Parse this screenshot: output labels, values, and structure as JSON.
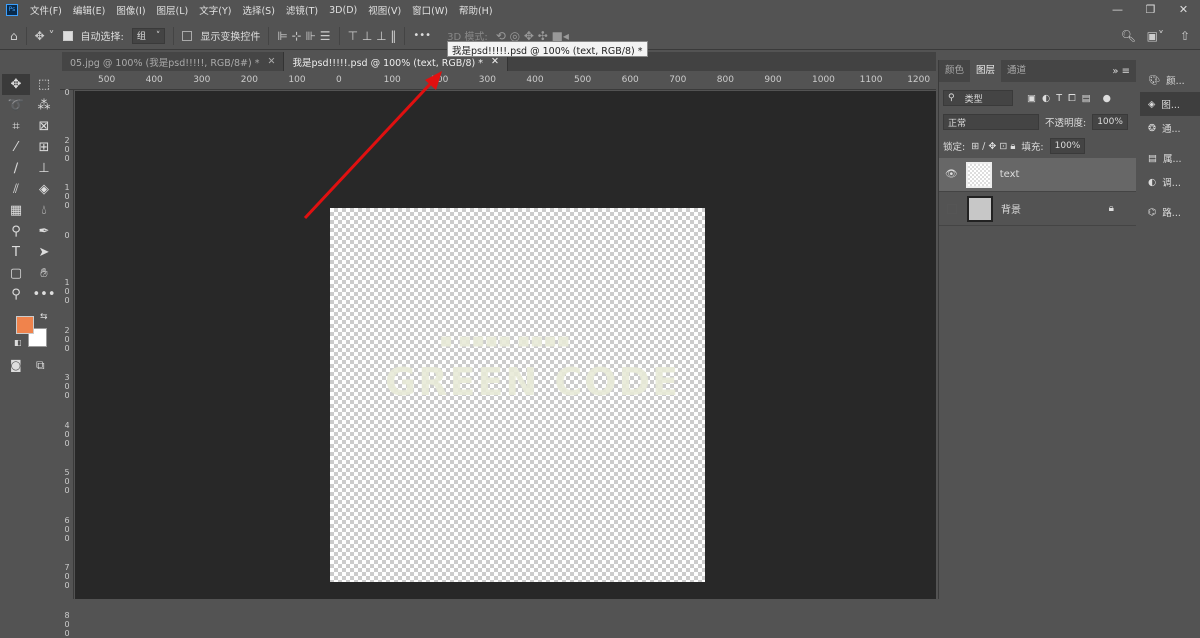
{
  "menu": {
    "logo": "Ps",
    "items": [
      "文件(F)",
      "编辑(E)",
      "图像(I)",
      "图层(L)",
      "文字(Y)",
      "选择(S)",
      "滤镜(T)",
      "3D(D)",
      "视图(V)",
      "窗口(W)",
      "帮助(H)"
    ]
  },
  "options": {
    "auto_select_label": "自动选择:",
    "auto_select_value": "组",
    "show_transform_label": "显示变换控件",
    "more": "•••",
    "mode_3d": "3D 模式:"
  },
  "tooltip": "我是psd!!!!!.psd @ 100% (text, RGB/8) *",
  "tabs": [
    {
      "label": "05.jpg @ 100% (我是psd!!!!!, RGB/8#) *",
      "active": false
    },
    {
      "label": "我是psd!!!!!.psd @ 100% (text, RGB/8) *",
      "active": true
    }
  ],
  "ruler_h": [
    "500",
    "400",
    "300",
    "200",
    "100",
    "0",
    "100",
    "200",
    "300",
    "400",
    "500",
    "600",
    "700",
    "800",
    "900",
    "1000",
    "1100",
    "1200"
  ],
  "ruler_v": [
    "0",
    "200",
    "100",
    "0",
    "100",
    "200",
    "300",
    "400",
    "500",
    "600",
    "700",
    "800"
  ],
  "colors": {
    "foreground": "#f0834c",
    "background": "#ffffff",
    "arrow": "#e01010"
  },
  "canvas": {
    "subtitle": "■ ■■■■ ■■■■",
    "title": "GREEN CODE"
  },
  "panel": {
    "tabs": [
      "颜色",
      "图层",
      "通道"
    ],
    "active_tab": "图层",
    "filter_label": "类型",
    "blend_mode": "正常",
    "opacity_label": "不透明度:",
    "opacity": "100%",
    "lock_label": "锁定:",
    "fill_label": "填充:",
    "fill": "100%",
    "layers": [
      {
        "name": "text",
        "visible": true,
        "active": true
      },
      {
        "name": "背景",
        "visible": false,
        "locked": true
      }
    ]
  },
  "side_icons": [
    {
      "icon": "palette-icon",
      "label": "颜..."
    },
    {
      "icon": "layers-icon",
      "label": "图..."
    },
    {
      "icon": "channels-icon",
      "label": "通..."
    },
    {
      "icon": "properties-icon",
      "label": "属..."
    },
    {
      "icon": "adjustments-icon",
      "label": "调..."
    },
    {
      "icon": "paths-icon",
      "label": "路..."
    }
  ]
}
